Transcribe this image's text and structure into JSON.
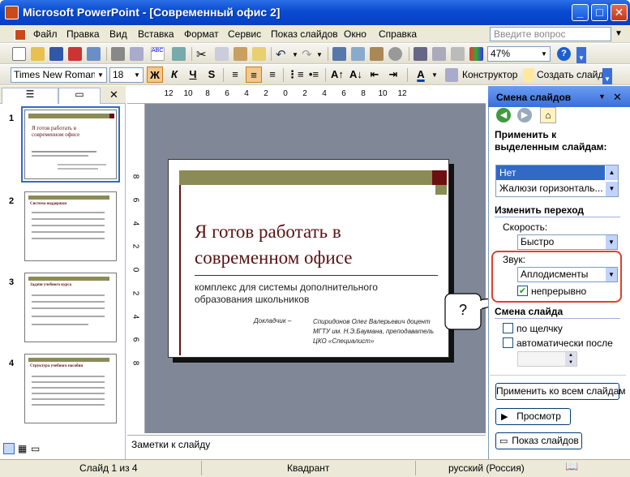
{
  "window": {
    "title": "Microsoft PowerPoint - [Современный офис 2]",
    "icon": "powerpoint-icon"
  },
  "menu": {
    "items": [
      "Файл",
      "Правка",
      "Вид",
      "Вставка",
      "Формат",
      "Сервис",
      "Показ слайдов",
      "Окно",
      "Справка"
    ],
    "help_placeholder": "Введите вопрос"
  },
  "toolbar": {
    "zoom": "47%",
    "font_name": "Times New Roman",
    "font_size": "18",
    "bold": "Ж",
    "italic": "К",
    "underline": "Ч",
    "shadow": "S",
    "designer_label": "Конструктор",
    "new_slide_label": "Создать слайд"
  },
  "thumbnails": [
    {
      "num": "1",
      "title": "Я готов работать в современном офисе"
    },
    {
      "num": "2",
      "title": "Система поддержки"
    },
    {
      "num": "3",
      "title": "Задачи учебного курса"
    },
    {
      "num": "4",
      "title": "Структура учебного пособия"
    }
  ],
  "ruler": {
    "top_ticks": [
      "12",
      "10",
      "8",
      "6",
      "4",
      "2",
      "0",
      "2",
      "4",
      "6",
      "8",
      "10",
      "12"
    ],
    "left_ticks": [
      "8",
      "6",
      "4",
      "2",
      "0",
      "2",
      "4",
      "6",
      "8"
    ]
  },
  "slide": {
    "title": "Я готов работать в современном офисе",
    "subtitle": "комплекс для системы дополнительного образования школьников",
    "speaker_label": "Докладчик –",
    "speaker_info": "Спиридонов Олег Валерьевич доцент МГТУ им. Н.Э.Баумана, преподаватель ЦКО «Специалист»"
  },
  "notes": {
    "placeholder": "Заметки к слайду"
  },
  "taskpane": {
    "title": "Смена слайдов",
    "apply_label": "Применить к выделенным слайдам:",
    "transitions": [
      "Нет",
      "Жалюзи горизонталь..."
    ],
    "modify_header": "Изменить переход",
    "speed_label": "Скорость:",
    "speed_value": "Быстро",
    "sound_label": "Звук:",
    "sound_value": "Аплодисменты",
    "loop_label": "непрерывно",
    "advance_header": "Смена слайда",
    "on_click_label": "по щелчку",
    "auto_label": "автоматически после",
    "apply_all_label": "Применить ко всем слайдам",
    "preview_label": "Просмотр",
    "slideshow_label": "Показ слайдов"
  },
  "callout": {
    "text": "?"
  },
  "status": {
    "slide_info": "Слайд 1 из 4",
    "design": "Квадрант",
    "language": "русский (Россия)"
  },
  "colors": {
    "accent_red": "#e0412b",
    "slide_bar": "#8b8b55",
    "slide_dark": "#6b0f12",
    "slide_text": "#5a1212",
    "selection": "#316ac5"
  }
}
